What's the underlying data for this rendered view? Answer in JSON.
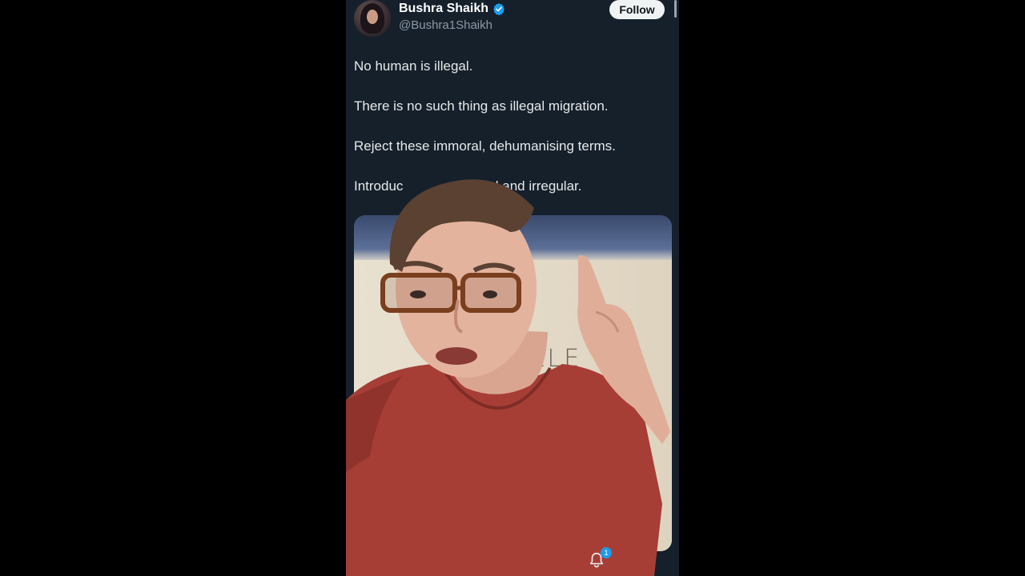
{
  "post": {
    "author_name": "Bushra Shaikh",
    "author_handle": "@Bushra1Shaikh",
    "verified": true,
    "follow_label": "Follow",
    "lines": [
      "No human is illegal.",
      "There is no such thing as illegal migration.",
      "Reject these immoral, dehumanising terms.",
      "Introduc",
      "nted and irregular."
    ],
    "media_visible_text": "ILLE"
  },
  "icons": {
    "verified": "verified-badge-icon",
    "notifications": "bell-icon"
  },
  "notifications": {
    "badge_count": "1"
  },
  "colors": {
    "background": "#15202b",
    "text": "#e7e9ea",
    "secondary_text": "#8b98a5",
    "accent": "#1d9bf0",
    "follow_bg": "#eff3f4"
  }
}
